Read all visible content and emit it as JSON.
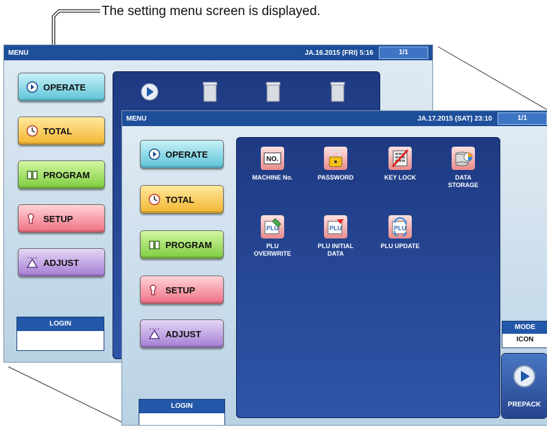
{
  "caption": "The setting menu screen is displayed.",
  "back_screen": {
    "title": "MENU",
    "datetime": "JA.16.2015 (FRI)  5:16",
    "page": "1/1",
    "buttons": [
      {
        "name": "operate",
        "label": "OPERATE"
      },
      {
        "name": "total",
        "label": "TOTAL"
      },
      {
        "name": "program",
        "label": "PROGRAM"
      },
      {
        "name": "setup",
        "label": "SETUP"
      },
      {
        "name": "adjust",
        "label": "ADJUST"
      }
    ],
    "login_label": "LOGIN"
  },
  "front_screen": {
    "title": "MENU",
    "datetime": "JA.17.2015 (SAT)  23:10",
    "page": "1/1",
    "buttons": [
      {
        "name": "operate",
        "label": "OPERATE"
      },
      {
        "name": "total",
        "label": "TOTAL"
      },
      {
        "name": "program",
        "label": "PROGRAM"
      },
      {
        "name": "setup",
        "label": "SETUP"
      },
      {
        "name": "adjust",
        "label": "ADJUST"
      }
    ],
    "login_label": "LOGIN",
    "tiles": [
      {
        "label": "MACHINE No.",
        "icon": "machine-no-icon"
      },
      {
        "label": "PASSWORD",
        "icon": "padlock-icon"
      },
      {
        "label": "KEY LOCK",
        "icon": "key-lock-icon"
      },
      {
        "label": "DATA\nSTORAGE",
        "icon": "data-storage-icon"
      },
      {
        "label": "PLU\nOVERWRITE",
        "icon": "plu-overwrite-icon"
      },
      {
        "label": "PLU INITIAL\nDATA",
        "icon": "plu-initial-data-icon"
      },
      {
        "label": "PLU UPDATE",
        "icon": "plu-update-icon"
      }
    ],
    "mode_label": "MODE",
    "mode_value": "ICON",
    "prepack_label": "PREPACK"
  },
  "colors": {
    "titlebar": "#1d4f9a",
    "panel": "#2547a0",
    "operate": "#5cc4d8",
    "total": "#f2b530",
    "program": "#7ccc3f",
    "setup": "#ef6f82",
    "adjust": "#a37dd3"
  }
}
